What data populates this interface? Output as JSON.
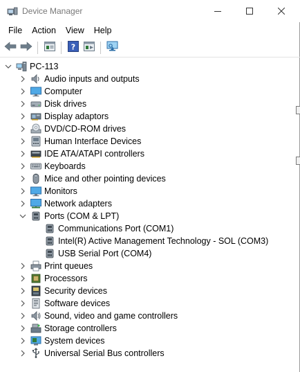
{
  "window": {
    "title": "Device Manager"
  },
  "menu": {
    "file": "File",
    "action": "Action",
    "view": "View",
    "help": "Help"
  },
  "toolbar": {
    "items": [
      "back-arrow-icon",
      "forward-arrow-icon",
      "properties-icon",
      "help-icon",
      "update-driver-icon",
      "scan-hardware-icon"
    ]
  },
  "tree": {
    "root": {
      "label": "PC-113",
      "expanded": true
    },
    "categories": [
      {
        "label": "Audio inputs and outputs",
        "icon": "speaker-icon"
      },
      {
        "label": "Computer",
        "icon": "computer-icon"
      },
      {
        "label": "Disk drives",
        "icon": "disk-drive-icon"
      },
      {
        "label": "Display adaptors",
        "icon": "display-adaptor-icon"
      },
      {
        "label": "DVD/CD-ROM drives",
        "icon": "dvd-icon"
      },
      {
        "label": "Human Interface Devices",
        "icon": "hid-icon"
      },
      {
        "label": "IDE ATA/ATAPI controllers",
        "icon": "ide-controller-icon"
      },
      {
        "label": "Keyboards",
        "icon": "keyboard-icon"
      },
      {
        "label": "Mice and other pointing devices",
        "icon": "mouse-icon"
      },
      {
        "label": "Monitors",
        "icon": "monitor-icon"
      },
      {
        "label": "Network adapters",
        "icon": "network-adapter-icon"
      },
      {
        "label": "Ports (COM & LPT)",
        "icon": "port-icon",
        "expanded": true,
        "children": [
          {
            "label": "Communications Port (COM1)",
            "icon": "port-icon"
          },
          {
            "label": "Intel(R) Active Management Technology - SOL (COM3)",
            "icon": "port-icon"
          },
          {
            "label": "USB Serial Port (COM4)",
            "icon": "port-icon"
          }
        ]
      },
      {
        "label": "Print queues",
        "icon": "printer-icon"
      },
      {
        "label": "Processors",
        "icon": "processor-icon"
      },
      {
        "label": "Security devices",
        "icon": "security-device-icon"
      },
      {
        "label": "Software devices",
        "icon": "software-device-icon"
      },
      {
        "label": "Sound, video and game controllers",
        "icon": "sound-icon"
      },
      {
        "label": "Storage controllers",
        "icon": "storage-controller-icon"
      },
      {
        "label": "System devices",
        "icon": "system-device-icon"
      },
      {
        "label": "Universal Serial Bus controllers",
        "icon": "usb-icon"
      }
    ]
  },
  "colors": {
    "accent": "#1e7fd6",
    "title_text": "#777777",
    "chevron": "#555555"
  }
}
